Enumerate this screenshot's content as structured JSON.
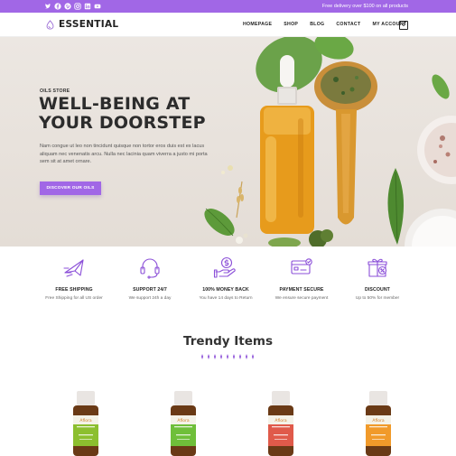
{
  "topbar": {
    "social_icons": [
      "twitter-icon",
      "facebook-icon",
      "pinterest-icon",
      "instagram-icon",
      "linkedin-icon",
      "youtube-icon"
    ],
    "note": "Free delivery over $100 on all products",
    "accent": "#a167e6"
  },
  "header": {
    "logo_text": "ESSENTIAL",
    "nav": [
      "HOMEPAGE",
      "SHOP",
      "BLOG",
      "CONTACT",
      "MY ACCOUNT"
    ],
    "cart_count": "0"
  },
  "hero": {
    "eyebrow": "OILS STORE",
    "title_line1": "WELL-BEING AT",
    "title_line2": "YOUR DOORSTEP",
    "body": "Nam congue ut leo non tincidunt quisque non tortor eros duis est ex lacus aliquam nec venenatis arcu. Nulla nec lacinia quam viverra a justo mi porta sem sit at amet ornare.",
    "button": "DISCOVER OUR OILS"
  },
  "features": [
    {
      "icon": "airplane-icon",
      "title": "FREE SHIPPING",
      "subtitle": "Free Shipping for all US order"
    },
    {
      "icon": "headset-icon",
      "title": "SUPPORT 24/7",
      "subtitle": "We support 24h a day"
    },
    {
      "icon": "money-back-icon",
      "title": "100% MONEY BACK",
      "subtitle": "You have 14 days to Return"
    },
    {
      "icon": "credit-card-icon",
      "title": "PAYMENT SECURE",
      "subtitle": "We ensure secure payment"
    },
    {
      "icon": "gift-discount-icon",
      "title": "DISCOUNT",
      "subtitle": "Up to 50% for member"
    }
  ],
  "section": {
    "title": "Trendy Items"
  },
  "products": [
    {
      "brand": "Aflora",
      "label_color": "#8cbf2f"
    },
    {
      "brand": "Aflora",
      "label_color": "#6fbf3a"
    },
    {
      "brand": "Aflora",
      "label_color": "#e05a4a"
    },
    {
      "brand": "Aflora",
      "label_color": "#f19a2a"
    }
  ]
}
